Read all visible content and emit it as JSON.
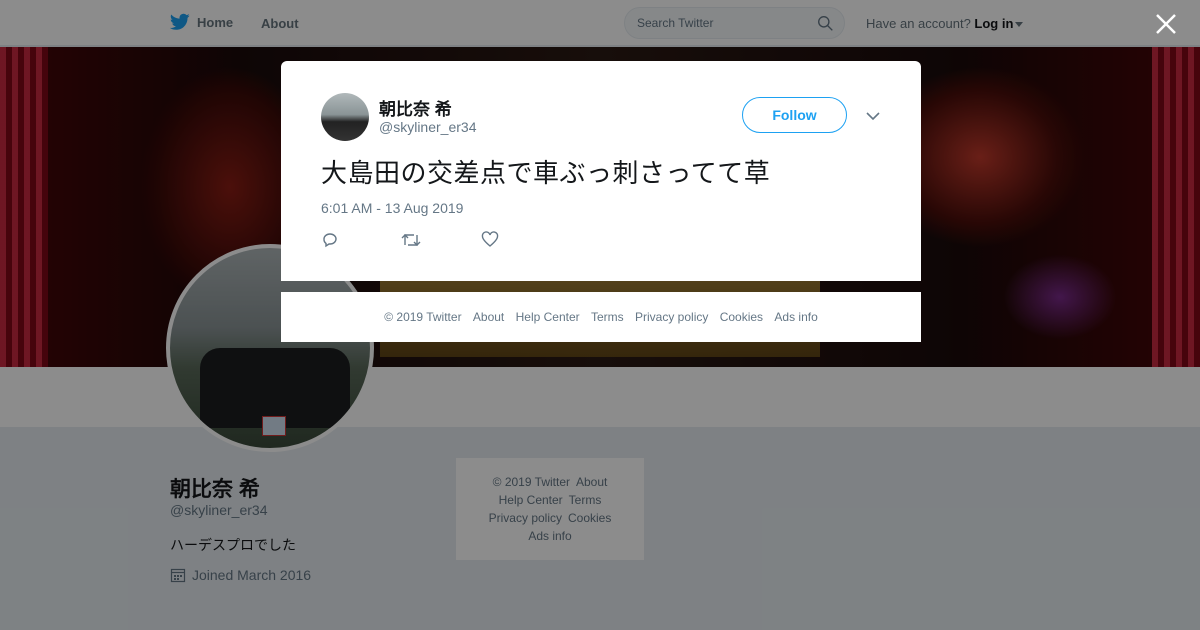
{
  "topbar": {
    "home_label": "Home",
    "about_label": "About",
    "search_placeholder": "Search Twitter",
    "account_prompt": "Have an account?",
    "login_label": "Log in"
  },
  "profile": {
    "name": "朝比奈 希",
    "handle": "@skyliner_er34",
    "bio": "ハーデスプロでした",
    "joined": "Joined March 2016"
  },
  "side_footer": {
    "copyright": "© 2019 Twitter",
    "about": "About",
    "help": "Help Center",
    "terms": "Terms",
    "privacy": "Privacy policy",
    "cookies": "Cookies",
    "ads": "Ads info"
  },
  "modal": {
    "name": "朝比奈 希",
    "handle": "@skyliner_er34",
    "follow_label": "Follow",
    "tweet_text": "大島田の交差点で車ぶっ刺さってて草",
    "timestamp": "6:01 AM - 13 Aug 2019"
  },
  "footer": {
    "copyright": "© 2019 Twitter",
    "about": "About",
    "help": "Help Center",
    "terms": "Terms",
    "privacy": "Privacy policy",
    "cookies": "Cookies",
    "ads": "Ads info"
  },
  "colors": {
    "accent": "#1da1f2",
    "muted_text": "#657786"
  }
}
